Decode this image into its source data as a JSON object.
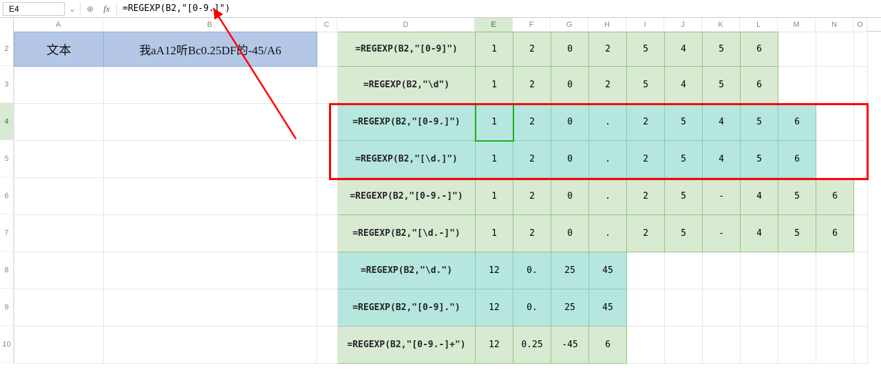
{
  "nameBox": "E4",
  "formulaInput": "=REGEXP(B2,\"[0-9.]\")",
  "columns": [
    "A",
    "B",
    "C",
    "D",
    "E",
    "F",
    "G",
    "H",
    "I",
    "J",
    "K",
    "L",
    "M",
    "N",
    "O"
  ],
  "rowNumbers": [
    "2",
    "3",
    "4",
    "5",
    "6",
    "7",
    "8",
    "9",
    "10"
  ],
  "activeColumn": "E",
  "activeRow": "4",
  "leftHeader": {
    "label": "文本",
    "value": "我aA12听Bc0.25DF的-45/A6"
  },
  "rows": [
    {
      "style": "green",
      "formula": "=REGEXP(B2,\"[0-9]\")",
      "vals": [
        "1",
        "2",
        "0",
        "2",
        "5",
        "4",
        "5",
        "6",
        "",
        ""
      ]
    },
    {
      "style": "green",
      "formula": "=REGEXP(B2,\"\\d\")",
      "vals": [
        "1",
        "2",
        "0",
        "2",
        "5",
        "4",
        "5",
        "6",
        "",
        ""
      ]
    },
    {
      "style": "teal",
      "formula": "=REGEXP(B2,\"[0-9.]\")",
      "vals": [
        "1",
        "2",
        "0",
        ".",
        "2",
        "5",
        "4",
        "5",
        "6",
        ""
      ]
    },
    {
      "style": "teal",
      "formula": "=REGEXP(B2,\"[\\d.]\")",
      "vals": [
        "1",
        "2",
        "0",
        ".",
        "2",
        "5",
        "4",
        "5",
        "6",
        ""
      ]
    },
    {
      "style": "green",
      "formula": "=REGEXP(B2,\"[0-9.-]\")",
      "vals": [
        "1",
        "2",
        "0",
        ".",
        "2",
        "5",
        "-",
        "4",
        "5",
        "6"
      ]
    },
    {
      "style": "green",
      "formula": "=REGEXP(B2,\"[\\d.-]\")",
      "vals": [
        "1",
        "2",
        "0",
        ".",
        "2",
        "5",
        "-",
        "4",
        "5",
        "6"
      ]
    },
    {
      "style": "teal",
      "formula": "=REGEXP(B2,\"\\d.\")",
      "vals": [
        "12",
        "0.",
        "25",
        "45",
        "",
        "",
        "",
        "",
        "",
        ""
      ]
    },
    {
      "style": "teal",
      "formula": "=REGEXP(B2,\"[0-9].\")",
      "vals": [
        "12",
        "0.",
        "25",
        "45",
        "",
        "",
        "",
        "",
        "",
        ""
      ]
    },
    {
      "style": "green",
      "formula": "=REGEXP(B2,\"[0-9.-]+\")",
      "vals": [
        "12",
        "0.25",
        "-45",
        "6",
        "",
        "",
        "",
        "",
        "",
        ""
      ]
    }
  ],
  "icons": {
    "fx": "fx",
    "search": "⊕",
    "chevron": "⌄"
  }
}
